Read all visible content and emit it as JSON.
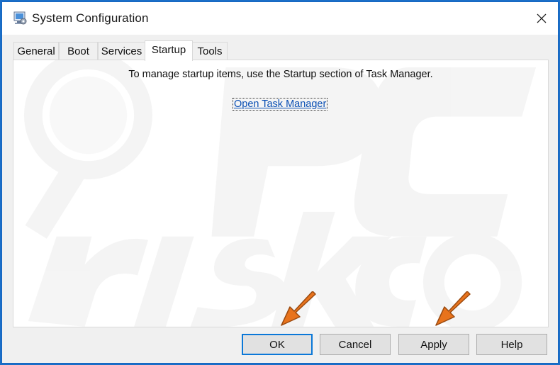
{
  "window": {
    "title": "System Configuration",
    "app_icon": "msconfig-icon",
    "close_icon": "close-icon"
  },
  "tabs": [
    {
      "label": "General",
      "active": false
    },
    {
      "label": "Boot",
      "active": false
    },
    {
      "label": "Services",
      "active": false
    },
    {
      "label": "Startup",
      "active": true
    },
    {
      "label": "Tools",
      "active": false
    }
  ],
  "startup_panel": {
    "message": "To manage startup items, use the Startup section of Task Manager.",
    "link_label": "Open Task Manager"
  },
  "buttons": {
    "ok": "OK",
    "cancel": "Cancel",
    "apply": "Apply",
    "help": "Help"
  },
  "annotations": {
    "arrow_color": "#e8731c",
    "arrow_icon": "orange-arrow-icon"
  },
  "colors": {
    "accent": "#0b78d8",
    "link": "#0a4fb4",
    "desktop": "#1b6fc8"
  }
}
